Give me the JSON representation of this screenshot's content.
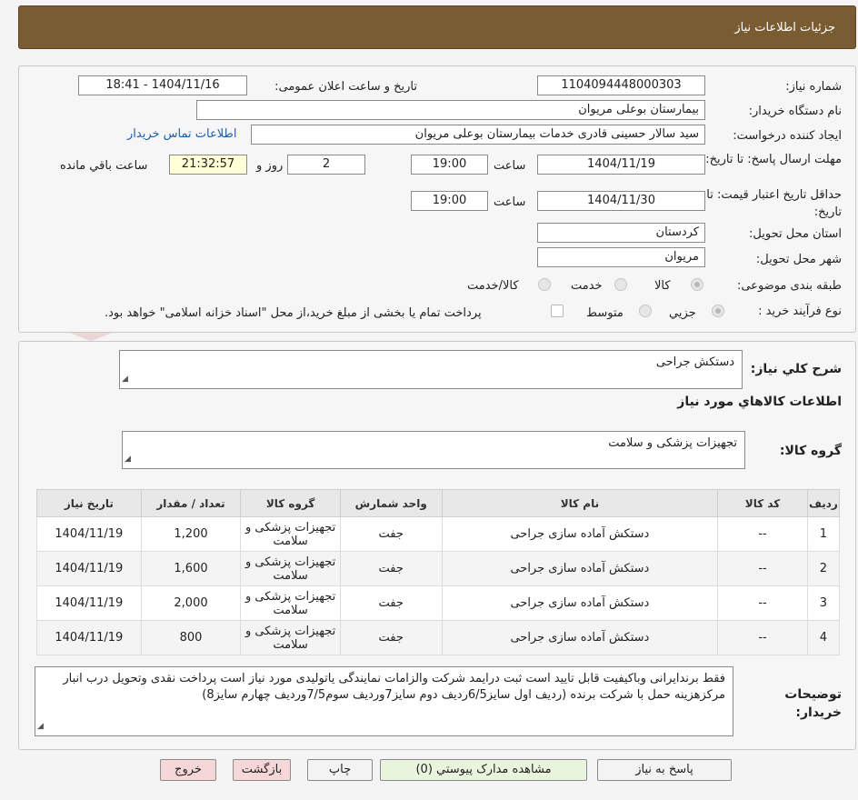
{
  "header": {
    "title": "جزئیات اطلاعات نیاز"
  },
  "form": {
    "need_number_label": "شماره نیاز:",
    "need_number": "1104094448000303",
    "announce_label": "تاریخ و ساعت اعلان عمومی:",
    "announce_value": "1404/11/16 - 18:41",
    "buyer_org_label": "نام دستگاه خریدار:",
    "buyer_org": "بیمارستان بوعلی مریوان",
    "requester_label": "ایجاد کننده درخواست:",
    "requester": "سید سالار حسینی قادری خدمات بیمارستان بوعلی مریوان",
    "contact_link": "اطلاعات تماس خریدار",
    "reply_deadline_label": "مهلت ارسال پاسخ: تا تاریخ:",
    "reply_date": "1404/11/19",
    "time_label": "ساعت",
    "reply_time": "19:00",
    "days_value": "2",
    "days_label": "روز و",
    "remaining_time": "21:32:57",
    "remaining_label": "ساعت باقي مانده",
    "price_validity_label": "حداقل تاریخ اعتبار قیمت: تا تاریخ:",
    "validity_date": "1404/11/30",
    "validity_time": "19:00",
    "province_label": "استان محل تحویل:",
    "province": "کردستان",
    "city_label": "شهر محل تحویل:",
    "city": "مریوان",
    "category_label": "طبقه بندی موضوعی:",
    "category_options": [
      "کالا",
      "خدمت",
      "کالا/خدمت"
    ],
    "purchase_type_label": "نوع فرآیند خرید :",
    "purchase_options": [
      "جزیي",
      "متوسط"
    ],
    "payment_note": "پرداخت تمام یا بخشی از مبلغ خرید،از محل \"اسناد خزانه اسلامی\" خواهد بود."
  },
  "details": {
    "general_desc_label": "شرح کلي نیاز:",
    "general_desc": "دستکش جراحی",
    "goods_info_title": "اطلاعات کالاهاي مورد نیاز",
    "goods_group_label": "گروه کالا:",
    "goods_group": "تجهیزات پزشکی و سلامت",
    "table": {
      "headers": [
        "ردیف",
        "کد کالا",
        "نام کالا",
        "واحد شمارش",
        "گروه کالا",
        "تعداد / مقدار",
        "تاریخ نیاز"
      ],
      "rows": [
        [
          "1",
          "--",
          "دستکش آماده سازی جراحی",
          "جفت",
          "تجهیزات پزشکی و سلامت",
          "1,200",
          "1404/11/19"
        ],
        [
          "2",
          "--",
          "دستکش آماده سازی جراحی",
          "جفت",
          "تجهیزات پزشکی و سلامت",
          "1,600",
          "1404/11/19"
        ],
        [
          "3",
          "--",
          "دستکش آماده سازی جراحی",
          "جفت",
          "تجهیزات پزشکی و سلامت",
          "2,000",
          "1404/11/19"
        ],
        [
          "4",
          "--",
          "دستکش آماده سازی جراحی",
          "جفت",
          "تجهیزات پزشکی و سلامت",
          "800",
          "1404/11/19"
        ]
      ]
    },
    "buyer_notes_label": "توضیحات خریدار:",
    "buyer_notes": "فقط برندایرانی وباکیفیت قابل تایید است ثبت درایمد شرکت والزامات نمایندگی یاتولیدی مورد نیاز است پرداخت نقدی وتحویل درب انبار مرکزهزینه حمل با شرکت برنده (ردیف اول سایز6/5ردیف دوم سایز7وردیف سوم7/5وردیف چهارم سایز8)"
  },
  "buttons": {
    "reply": "پاسخ به نیاز",
    "attachments": "مشاهده مدارک پیوستي (0)",
    "print": "چاپ",
    "back": "بازگشت",
    "exit": "خروج"
  },
  "watermark": {
    "text": "AriaTender.neT"
  }
}
